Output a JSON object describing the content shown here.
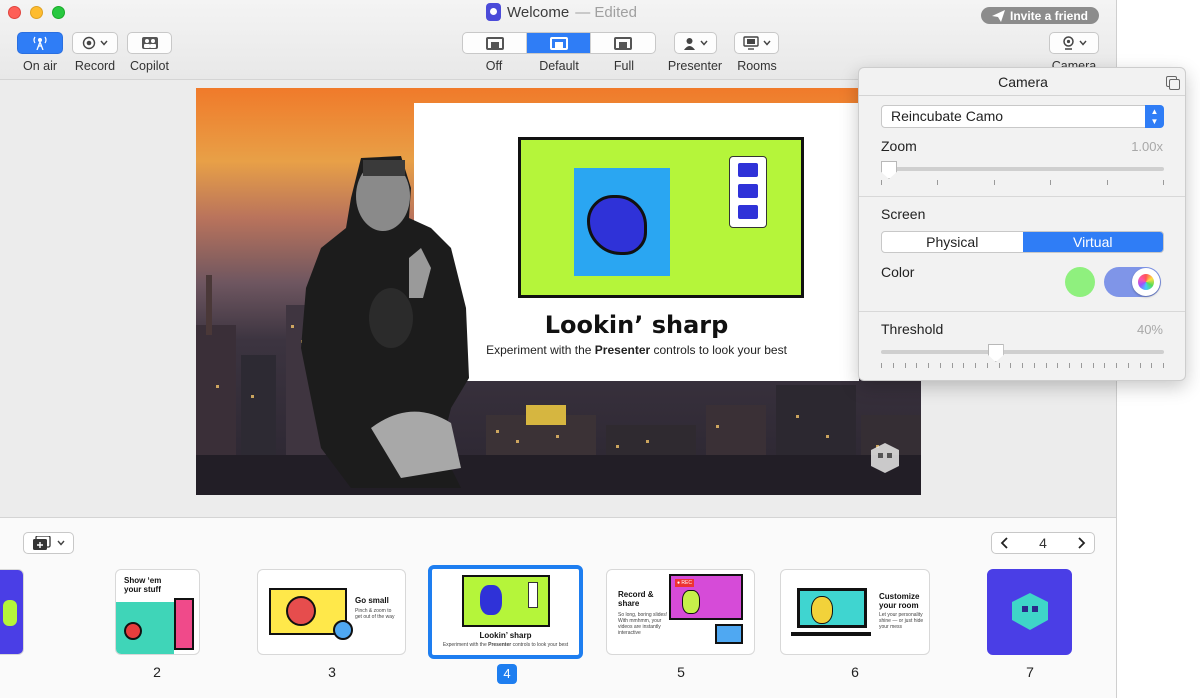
{
  "window": {
    "title": "Welcome",
    "title_status": "— Edited",
    "invite_label": "Invite a friend"
  },
  "toolbar": {
    "on_air_label": "On air",
    "record_label": "Record",
    "copilot_label": "Copilot",
    "layout_options": [
      "Off",
      "Default",
      "Full"
    ],
    "layout_selected": "Default",
    "presenter_label": "Presenter",
    "rooms_label": "Rooms",
    "camera_label": "Camera"
  },
  "stage": {
    "slide_heading": "Lookin’ sharp",
    "slide_sub_before": "Experiment with the ",
    "slide_sub_bold": "Presenter",
    "slide_sub_after": " controls to look your best"
  },
  "filmstrip": {
    "current_page": "4",
    "slides": [
      {
        "number": "2",
        "title": "Show ‘em your stuff"
      },
      {
        "number": "3",
        "title": "Go small",
        "text": "Pinch & zoom to get out of the way"
      },
      {
        "number": "4",
        "title": "Lookin’ sharp",
        "text_before": "Experiment with the ",
        "text_bold": "Presenter",
        "text_after": " controls to look your best",
        "selected": true
      },
      {
        "number": "5",
        "title": "Record & share",
        "text": "So long, boring slides! With mmhmm, your videos are instantly interactive",
        "badge": "● REC"
      },
      {
        "number": "6",
        "title": "Customize your room",
        "text": "Let your personality shine — or just hide your mess"
      },
      {
        "number": "7"
      }
    ]
  },
  "camera_panel": {
    "title": "Camera",
    "device": "Reincubate Camo",
    "zoom_label": "Zoom",
    "zoom_value": "1.00x",
    "zoom_level": 0.0,
    "screen_label": "Screen",
    "screen_options": [
      "Physical",
      "Virtual"
    ],
    "screen_selected": "Virtual",
    "color_label": "Color",
    "color_swatch": "#8ff07e",
    "threshold_label": "Threshold",
    "threshold_value": "40%",
    "threshold_level": 0.4
  },
  "colors": {
    "accent": "#2f7df6",
    "selection": "#1e7ef0"
  }
}
